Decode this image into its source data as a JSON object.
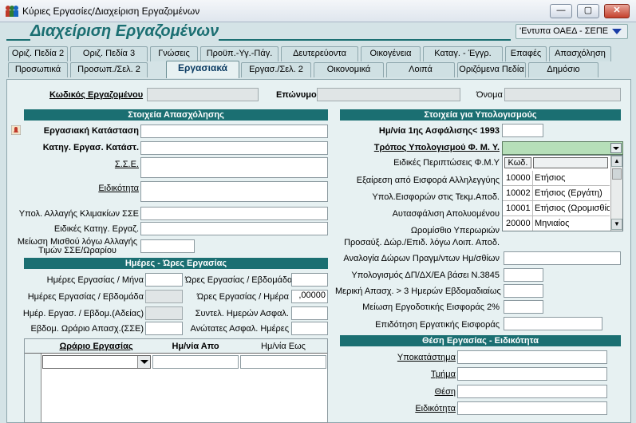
{
  "window": {
    "title": "Κύριες Εργασίες/Διαχείριση Εργαζομένων",
    "min": "—",
    "max": "▢",
    "close": "✕"
  },
  "header": {
    "title": "Διαχείριση Εργαζομένων",
    "dropdown": "'Εντυπα ΟΑΕΔ - ΣΕΠΕ"
  },
  "tabs_row1": [
    "Οριζ. Πεδία 2",
    "Οριζ. Πεδία 3",
    "Γνώσεις",
    "Προϋπ.-Υγ.-Πάγ.",
    "Δευτερεύοντα",
    "Οικογένεια",
    "Καταγ. - Έγγρ.",
    "Επαφές",
    "Απασχόληση"
  ],
  "tabs_row2": [
    "Προσωπικά",
    "Προσωπ./Σελ. 2",
    "Εργασιακά",
    "Εργασ./Σελ. 2",
    "Οικονομικά",
    "Λοιπά",
    "Οριζόμενα Πεδία",
    "Δημόσιο"
  ],
  "top": {
    "code_label": "Κωδικός Εργαζομένου",
    "surname_label": "Επώνυμο",
    "name_label": "Όνομα"
  },
  "left": {
    "section1": "Στοιχεία Απασχόλησης",
    "work_status": "Εργασιακή Κατάσταση",
    "work_status_cat": "Κατηγ. Εργασ. Κατάστ.",
    "sse": "Σ.Σ.Ε.",
    "specialty": "Ειδικότητα",
    "calc_change": "Υπολ. Αλλαγής Κλιμακίων ΣΣΕ",
    "special_cat": "Ειδικές Κατηγ. Εργαζ.",
    "salary_reduction": "Μείωση Μισθού λόγω Αλλαγής Τιμών ΣΣΕ/Ωραρίου",
    "section2": "Ημέρες - Ώρες Εργασίας",
    "days_month": "Ημέρες Εργασίας / Μήνα",
    "days_week": "Ημέρες Εργασίας / Εβδομάδα",
    "days_leave": "Ημέρ. Εργασ. / Εβδομ.(Αδείας)",
    "weekly_hours": "Εβδομ. Ωράριο Απασχ.(ΣΣΕ)",
    "hours_week": "Ώρες Εργασίας / Εβδομάδα",
    "hours_day": "Ώρες Εργασίας / Ημέρα",
    "hours_day_value": ",00000",
    "ins_days_coef": "Συντελ. Ημερών Ασφαλ.",
    "max_ins_days": "Ανώτατες Ασφαλ. Ημέρες",
    "grid": {
      "col1": "Ωράριο Εργασίας",
      "col2": "Ημ/νία Απο",
      "col3": "Ημ/νία Εως"
    }
  },
  "right": {
    "section1": "Στοιχεία για Υπολογισμούς",
    "first_ins_date": "Ημ/νία 1ης Ασφάλισης< 1993",
    "calc_method": "Τρόπος Υπολογισμού Φ. Μ. Υ.",
    "special_cases": "Ειδικές Περιπτώσεις Φ.Μ.Υ",
    "solidarity_exempt": "Εξαίρεση από Εισφορά Αλληλεγγύης",
    "contrib_calc": "Υπολ.Εισφορών στις Τεκμ.Αποδ.",
    "self_insurance": "Αυτασφάλιση Απολυομένου",
    "hourly_overtime": "Ωρομίσθιο Υπερωριών",
    "gift_increase": "Προσαύξ. Δώρ./Επιδ. λόγω Λοιπ. Αποδ.",
    "gift_ratio": "Αναλογία Δώρων Πραγμ/ντων Ημ/σθίων",
    "calc_dp": "Υπολογισμός ΔΠ/ΔΧ/ΕΑ βάσει Ν.3845",
    "partial": "Μερική Απασχ. > 3 Ημερών Εβδομαδιαίως",
    "employer_reduction": "Μείωση Εργοδοτικής Εισφοράς 2%",
    "employee_subsidy": "Επιδότηση Εργατικής Εισφοράς",
    "section2": "Θέση Εργασίας - Ειδικότητα",
    "branch": "Υποκατάστημα",
    "department": "Τμήμα",
    "position": "Θέση",
    "specialty2": "Ειδικότητα",
    "dropdown": {
      "header_code": "Κωδ.",
      "items": [
        {
          "code": "10000",
          "label": "Ετήσιος"
        },
        {
          "code": "10002",
          "label": "Ετήσιος (Εργάτη)"
        },
        {
          "code": "10001",
          "label": "Ετήσιος (Ωρομισθίου)"
        },
        {
          "code": "20000",
          "label": "Μηνιαίος"
        }
      ]
    }
  },
  "icons": {
    "users": "users-icon",
    "bell": "bell-icon"
  }
}
